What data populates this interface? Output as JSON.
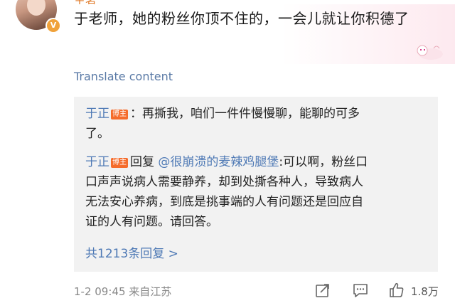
{
  "post": {
    "username": "王者",
    "text": "于老师，她的粉丝你顶不住的，一会儿就让你积德了",
    "translate_label": "Translate content"
  },
  "replies": [
    {
      "author": "于正",
      "badge": "博主",
      "segments": [
        "：再撕我，咱们一件件慢慢聊，能聊的可多",
        "了。"
      ]
    },
    {
      "author": "于正",
      "badge": "博主",
      "prefix": "回复",
      "mention": "@很崩溃的麦辣鸡腿堡",
      "segments": [
        ":可以啊，粉丝口",
        "口声声说病人需要静养，却到处撕各种人，导致病人",
        "无法安心养病，到底是挑事端的人有问题还是回应自",
        "证的人有问题。请回答。"
      ]
    }
  ],
  "more_replies_label": "共1213条回复 >",
  "footer": {
    "time_source": "1-2 09:45  来自江苏",
    "like_count": "1.8万"
  },
  "icons": [
    "verified-v-icon",
    "share-icon",
    "comment-icon",
    "like-thumb-icon"
  ],
  "colors": {
    "link": "#4e79b5",
    "badge": "#f56c2c",
    "muted": "#888888"
  }
}
